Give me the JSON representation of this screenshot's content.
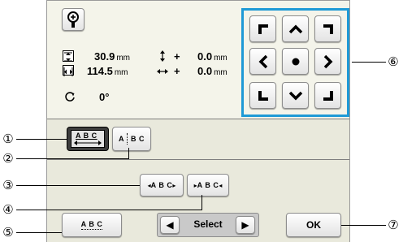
{
  "info": {
    "height_value": "30.9",
    "width_value": "114.5",
    "unit": "mm",
    "v_offset": "0.0",
    "h_offset": "0.0",
    "plus": "+",
    "rotation": "0°"
  },
  "text_buttons": {
    "spacing_label": "A B C",
    "split_label": "A",
    "split_label2": "B C",
    "widen_label": "A B C",
    "narrow_label": "A B C",
    "underline_label": "A B C",
    "arc_label": "A B C"
  },
  "select": {
    "label": "Select",
    "prev_glyph": "◀",
    "next_glyph": "▶"
  },
  "ok_label": "OK",
  "callouts": [
    "①",
    "②",
    "③",
    "④",
    "⑤",
    "⑥",
    "⑦"
  ],
  "colors": {
    "panel_border": "#1f9ad6",
    "active_button": "#3c3c3c"
  }
}
